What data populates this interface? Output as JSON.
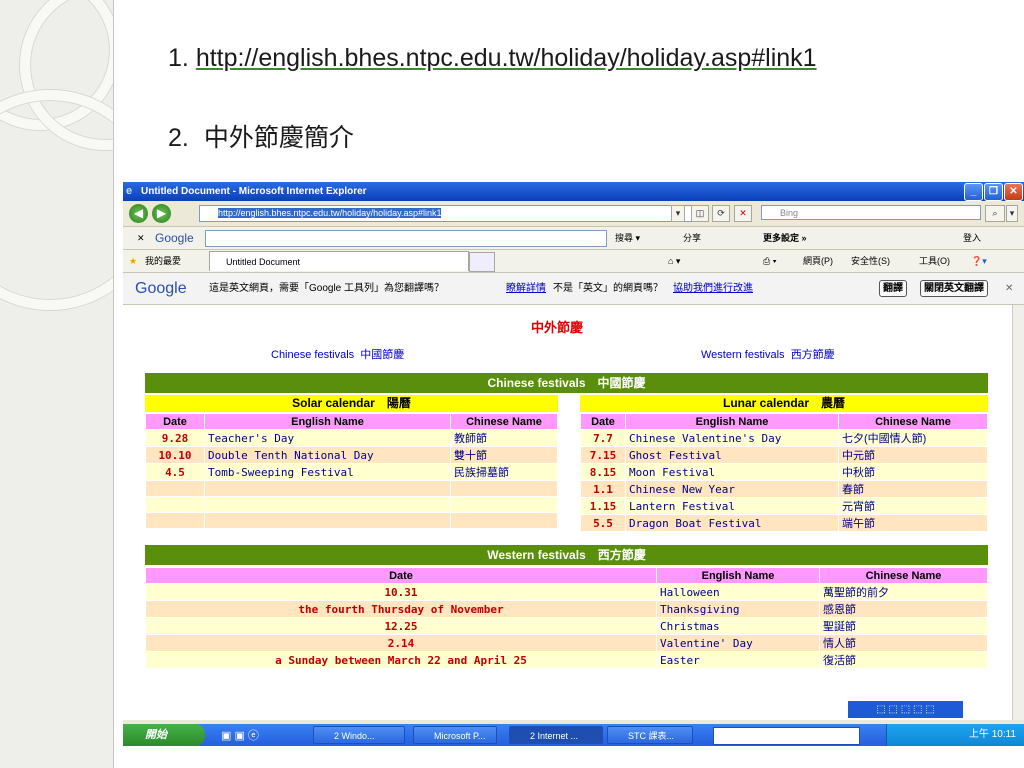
{
  "slide": {
    "item1_num": "1.",
    "item1_link": "http://english.bhes.ntpc.edu.tw/holiday/holiday.asp#link1",
    "item2_num": "2.",
    "item2_text": "中外節慶簡介"
  },
  "window": {
    "title": "Untitled Document - Microsoft Internet Explorer",
    "address": "http://english.bhes.ntpc.edu.tw/holiday/holiday.asp#link1",
    "search_placeholder": "Bing",
    "tab_title": "Untitled Document",
    "favorites": "我的最愛"
  },
  "google_toolbar": {
    "logo": "Google",
    "search_btn": "搜尋",
    "share": "分享",
    "more": "更多設定 »",
    "login": "登入"
  },
  "ie_menu": {
    "page": "網頁(P)",
    "safety": "安全性(S)",
    "tools": "工具(O)"
  },
  "translate_bar": {
    "logo": "Google",
    "message": "這是英文網頁，需要「Google 工具列」為您翻譯嗎？",
    "details": "瞭解詳情",
    "not_english": "不是「英文」的網頁嗎？",
    "help": "協助我們進行改進",
    "translate_btn": "翻譯",
    "close_btn": "關閉英文翻譯"
  },
  "page": {
    "heading": "中外節慶",
    "link_chinese_en": "Chinese festivals",
    "link_chinese_zh": "中國節慶",
    "link_western_en": "Western festivals",
    "link_western_zh": "西方節慶",
    "chinese_header": "Chinese festivals　中國節慶",
    "solar_header": "Solar calendar　陽曆",
    "lunar_header": "Lunar calendar　農曆",
    "col_date": "Date",
    "col_en": "English Name",
    "col_zh": "Chinese Name",
    "solar_rows": [
      {
        "date": "9.28",
        "en": "Teacher's Day",
        "zh": "教師節"
      },
      {
        "date": "10.10",
        "en": "Double Tenth National Day",
        "zh": "雙十節"
      },
      {
        "date": "4.5",
        "en": "Tomb-Sweeping Festival",
        "zh": "民族掃墓節"
      }
    ],
    "lunar_rows": [
      {
        "date": "7.7",
        "en": "Chinese Valentine's Day",
        "zh": "七夕(中國情人節)"
      },
      {
        "date": "7.15",
        "en": "Ghost Festival",
        "zh": "中元節"
      },
      {
        "date": "8.15",
        "en": "Moon Festival",
        "zh": "中秋節"
      },
      {
        "date": "1.1",
        "en": "Chinese New Year",
        "zh": "春節"
      },
      {
        "date": "1.15",
        "en": "Lantern Festival",
        "zh": "元宵節"
      },
      {
        "date": "5.5",
        "en": "Dragon Boat Festival",
        "zh": "端午節"
      }
    ],
    "western_header": "Western festivals　西方節慶",
    "western_rows": [
      {
        "date": "10.31",
        "en": "Halloween",
        "zh": "萬聖節的前夕"
      },
      {
        "date": "the fourth Thursday of November",
        "en": "Thanksgiving",
        "zh": "感恩節"
      },
      {
        "date": "12.25",
        "en": "Christmas",
        "zh": "聖誕節"
      },
      {
        "date": "2.14",
        "en": "Valentine' Day",
        "zh": "情人節"
      },
      {
        "date": "a Sunday between March 22 and April 25",
        "en": "Easter",
        "zh": "復活節"
      }
    ]
  },
  "taskbar": {
    "start": "開始",
    "tasks": [
      "2 Windo...",
      "Microsoft P...",
      "2 Internet ...",
      "STC 課表..."
    ],
    "clock": "上午 10:11"
  }
}
